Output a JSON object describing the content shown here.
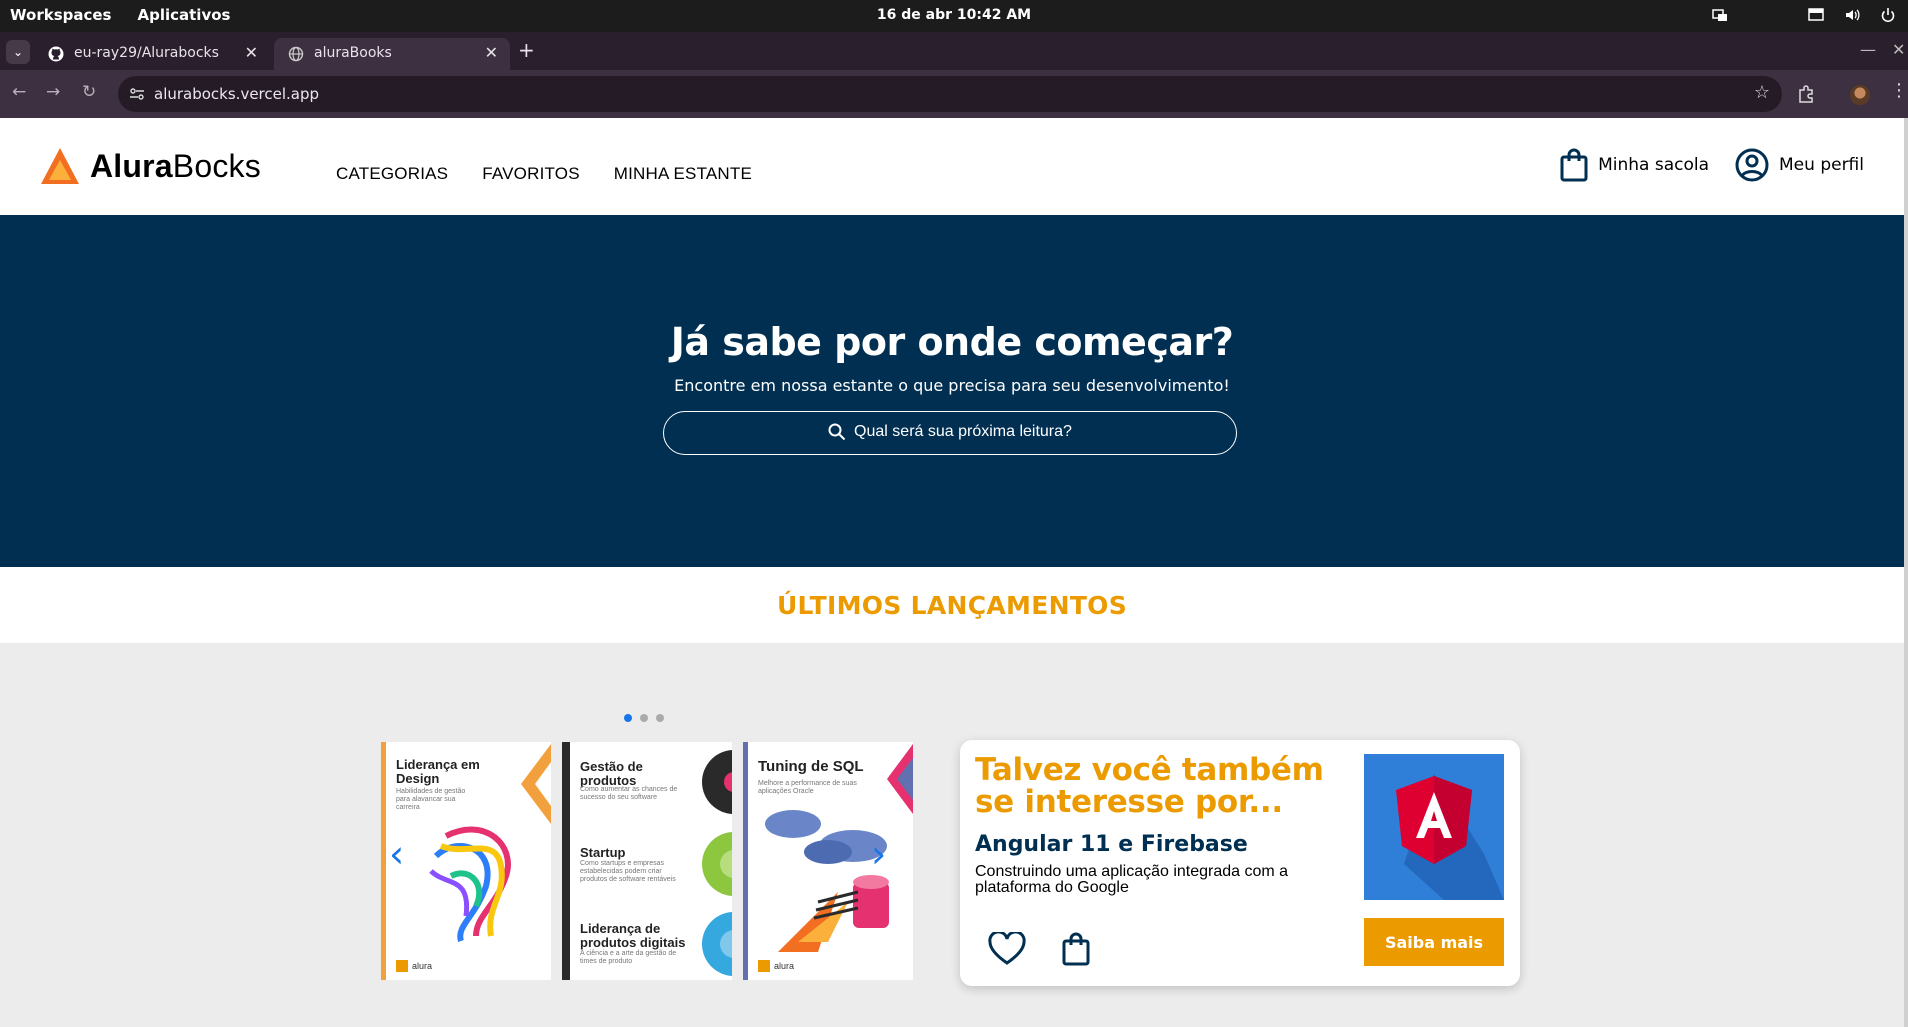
{
  "os": {
    "workspaces": "Workspaces",
    "apps": "Aplicativos",
    "clock": "16 de abr  10:42 AM"
  },
  "browser": {
    "tabs": [
      {
        "title": "eu-ray29/Alurabocks",
        "favicon": "github-icon"
      },
      {
        "title": "aluraBooks",
        "favicon": "globe-icon"
      }
    ],
    "url": "alurabocks.vercel.app"
  },
  "site": {
    "logo_bold": "Alura",
    "logo_rest": "Bocks",
    "nav": [
      "CATEGORIAS",
      "FAVORITOS",
      "MINHA ESTANTE"
    ],
    "bag": "Minha sacola",
    "profile": "Meu perfil"
  },
  "hero": {
    "title": "Já sabe por onde começar?",
    "subtitle": "Encontre em nossa estante o que precisa para seu desenvolvimento!",
    "search_placeholder": "Qual será sua próxima leitura?"
  },
  "launches": {
    "title": "ÚLTIMOS LANÇAMENTOS",
    "books": [
      {
        "title": "Liderança em Design",
        "subtitle": "Habilidades de gestão para alavancar sua carreira",
        "accent": "#f2a03d"
      },
      {
        "title": "Gestão de produtos",
        "subtitle": "Como aumentar as chances de sucesso do seu software",
        "title2": "Startup",
        "subtitle2": "Como startups e empresas estabelecidas podem criar produtos de software rentáveis",
        "title3": "Liderança de produtos digitais",
        "subtitle3": "A ciência e a arte da gestão de times de produto",
        "accent": "#2a2a2a"
      },
      {
        "title": "Tuning de SQL",
        "subtitle": "Melhore a performance de suas aplicações Oracle",
        "accent": "#6070b0"
      }
    ],
    "publisher": "alura"
  },
  "recommendation": {
    "heading": "Talvez você também se interesse por...",
    "book_title": "Angular 11 e Firebase",
    "description": "Construindo uma aplicação integrada com a plataforma do Google",
    "cta": "Saiba mais"
  },
  "colors": {
    "brand_blue": "#002f52",
    "brand_orange": "#eb9b00",
    "accent_blue": "#1875e8"
  }
}
